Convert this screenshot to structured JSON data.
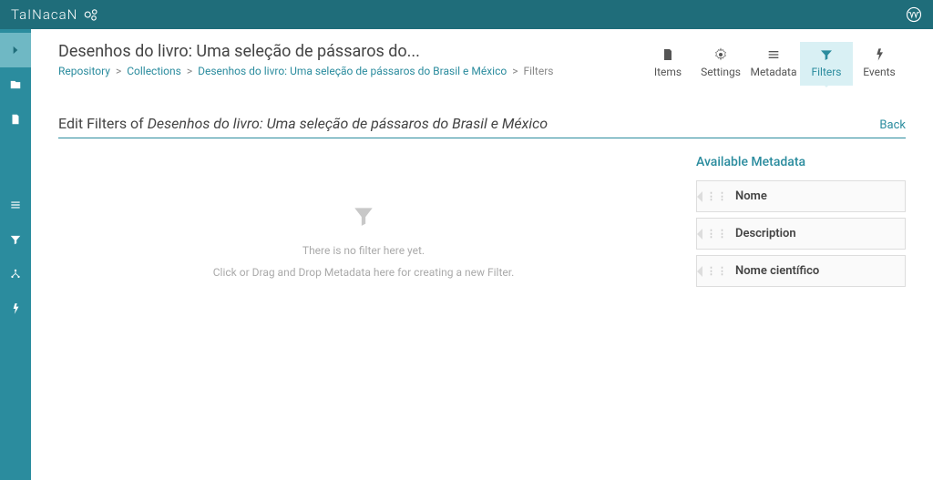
{
  "brand": "TaINacaN",
  "header": {
    "title": "Desenhos do livro: Uma seleção de pássaros do...",
    "breadcrumb": {
      "repository": "Repository",
      "collections": "Collections",
      "collection": "Desenhos do livro: Uma seleção de pássaros do Brasil e México",
      "current": "Filters"
    }
  },
  "tabs": {
    "items": "Items",
    "settings": "Settings",
    "metadata": "Metadata",
    "filters": "Filters",
    "events": "Events"
  },
  "section": {
    "prefix": "Edit Filters of ",
    "collection": "Desenhos do livro: Uma seleção de pássaros do Brasil e México",
    "back": "Back"
  },
  "dropzone": {
    "line1": "There is no filter here yet.",
    "line2": "Click or Drag and Drop Metadata here for creating a new Filter."
  },
  "metadata": {
    "title": "Available Metadata",
    "items": [
      "Nome",
      "Description",
      "Nome científico"
    ]
  }
}
